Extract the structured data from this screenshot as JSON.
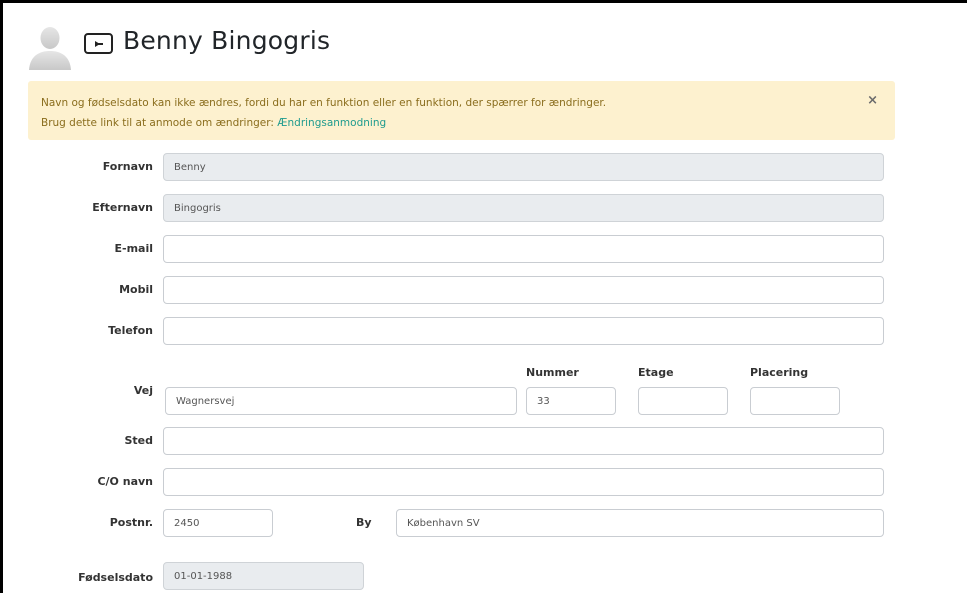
{
  "header": {
    "name": "Benny Bingogris",
    "avatar_icon": "user-avatar-icon",
    "card_icon": "id-card-icon"
  },
  "alert": {
    "line1": "Navn og fødselsdato kan ikke ændres, fordi du har en funktion eller en funktion, der spærrer for ændringer.",
    "line2_prefix": "Brug dette link til at anmode om ændringer: ",
    "link_text": "Ændringsanmodning",
    "close": "×"
  },
  "form": {
    "fornavn": {
      "label": "Fornavn",
      "value": "Benny"
    },
    "efternavn": {
      "label": "Efternavn",
      "value": "Bingogris"
    },
    "email": {
      "label": "E-mail",
      "value": ""
    },
    "mobil": {
      "label": "Mobil",
      "value": ""
    },
    "telefon": {
      "label": "Telefon",
      "value": ""
    },
    "vej": {
      "label": "Vej",
      "value": "Wagnersvej"
    },
    "nummer": {
      "label": "Nummer",
      "value": "33"
    },
    "etage": {
      "label": "Etage",
      "value": ""
    },
    "placering": {
      "label": "Placering",
      "value": ""
    },
    "sted": {
      "label": "Sted",
      "value": ""
    },
    "co_navn": {
      "label": "C/O navn",
      "value": ""
    },
    "postnr": {
      "label": "Postnr.",
      "value": "2450"
    },
    "by": {
      "label": "By",
      "value": "København SV"
    },
    "foedselsdato": {
      "label": "Fødselsdato",
      "value": "01-01-1988"
    }
  }
}
